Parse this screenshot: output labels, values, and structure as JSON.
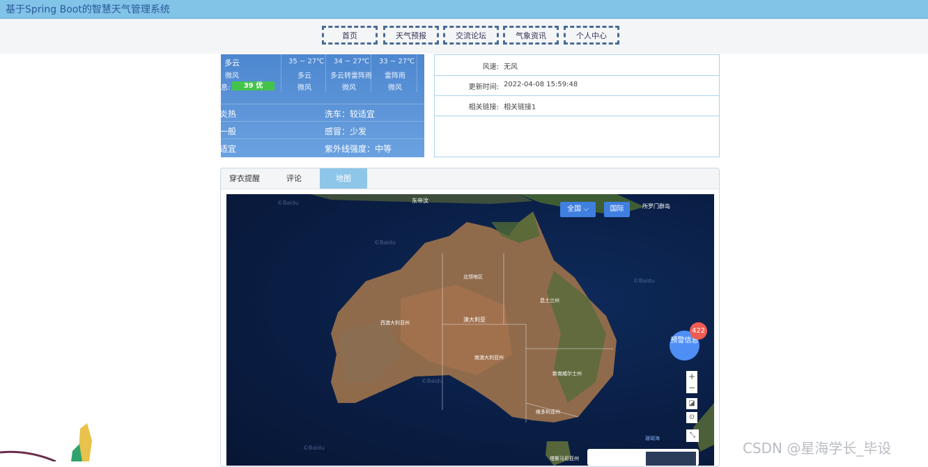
{
  "app": {
    "title": "基于Spring Boot的智慧天气管理系统"
  },
  "nav": [
    "首页",
    "天气预报",
    "交流论坛",
    "气象资讯",
    "个人中心"
  ],
  "weather": {
    "today_cond": "多云",
    "today_wind": "微风",
    "aqi_label": "39 优",
    "aqi_color": "#44c34b",
    "forecast": [
      {
        "temp": "35 ~ 27℃",
        "cond": "多云",
        "wind": "微风"
      },
      {
        "temp": "34 ~ 27℃",
        "cond": "多云转雷阵雨",
        "wind": "微风"
      },
      {
        "temp": "33 ~ 27℃",
        "cond": "雷阵雨",
        "wind": "微风"
      }
    ],
    "indices_left": [
      "炎热",
      "一般",
      "适宜"
    ],
    "indices_right": [
      "洗车：较适宜",
      "感冒：少发",
      "紫外线强度：中等"
    ]
  },
  "info": [
    {
      "label": "风速:",
      "value": "无风"
    },
    {
      "label": "更新时间:",
      "value": "2022-04-08 15:59:48"
    },
    {
      "label": "相关链接:",
      "value": "相关链接1"
    }
  ],
  "tabs": [
    "穿衣提醒",
    "评论",
    "地图"
  ],
  "active_tab": "地图",
  "map": {
    "btn_country": "全国",
    "btn_intl": "国际",
    "labels": {
      "timor": "东帝汶",
      "solomon": "所罗门群岛",
      "australia": "澳大利亚",
      "nt": "北领地区",
      "qld": "昆士兰州",
      "wa": "西澳大利亚州",
      "sa": "南澳大利亚州",
      "nsw": "新南威尔士州",
      "vic": "维多利亚州",
      "tas": "塔斯马尼亚州",
      "coral": "珊瑚海"
    },
    "watermark": "©Baidu",
    "warning_label": "预警信息",
    "warning_count": "422",
    "zoom_in": "+",
    "zoom_out": "−"
  },
  "watermark_csdn": "CSDN @星海学长_毕设"
}
